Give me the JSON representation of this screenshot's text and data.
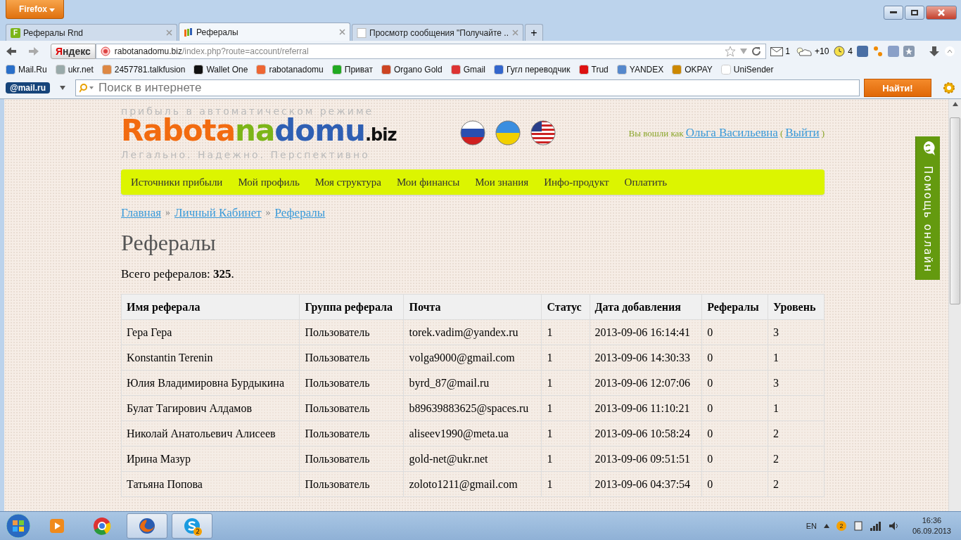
{
  "window": {
    "app_button": "Firefox"
  },
  "tabs": [
    {
      "label": "Рефералы Rnd",
      "kind": "letter",
      "icon": "F",
      "selected": false
    },
    {
      "label": "Рефералы",
      "kind": "bars",
      "selected": true
    },
    {
      "label": "Просмотр сообщения \"Получайте ...",
      "kind": "blank",
      "selected": false
    }
  ],
  "new_tab": "+",
  "navbar": {
    "search_engine": "Яндекс",
    "url_host": "rabotanadomu.biz",
    "url_path": "/index.php?route=account/referral",
    "mail_count": "1",
    "weather": "+10",
    "time_count": "4"
  },
  "bookmarks": [
    "Mail.Ru",
    "ukr.net",
    "2457781.talkfusion",
    "Wallet One",
    "rabotanadomu",
    "Приват",
    "Organo Gold",
    "Gmail",
    "Гугл переводчик",
    "Trud",
    "YANDEX",
    "OKPAY",
    "UniSender"
  ],
  "mailru_bar": {
    "logo": "@mail.ru",
    "placeholder": "Поиск в интернете",
    "button": "Найти!"
  },
  "site": {
    "tagline_top": "прибыль в автоматическом режиме",
    "logo": [
      {
        "text": "Rabota",
        "color": "#f26b10"
      },
      {
        "text": "na",
        "color": "#7cb518"
      },
      {
        "text": "domu",
        "color": "#2f5fb3"
      },
      {
        "text": ".biz",
        "color": "#111111"
      }
    ],
    "tagline_bottom": "Легально. Надежно. Перспективно",
    "login": {
      "prefix": "Вы вошли как",
      "user": "Ольга Васильевна",
      "open": "(",
      "logout": "Выйти",
      "close": ")"
    },
    "menu": [
      "Источники прибыли",
      "Мой профиль",
      "Моя структура",
      "Мои финансы",
      "Мои знания",
      "Инфо-продукт",
      "Оплатить"
    ],
    "breadcrumbs": [
      "Главная",
      "Личный Кабинет",
      "Рефералы"
    ],
    "breadcrumb_separator": "»",
    "heading": "Рефералы",
    "total": "Всего рефералов: **325**.",
    "help": "Помощь онлайн"
  },
  "table": {
    "columns": [
      "Имя реферала",
      "Группа реферала",
      "Почта",
      "Статус",
      "Дата добавления",
      "Рефералы",
      "Уровень"
    ],
    "rows": [
      [
        "Гера Гера",
        "Пользователь",
        "torek.vadim@yandex.ru",
        "1",
        "2013-09-06 16:14:41",
        "0",
        "3"
      ],
      [
        "Konstantin Terenin",
        "Пользователь",
        "volga9000@gmail.com",
        "1",
        "2013-09-06 14:30:33",
        "0",
        "1"
      ],
      [
        "Юлия Владимировна Бурдыкина",
        "Пользователь",
        "byrd_87@mail.ru",
        "1",
        "2013-09-06 12:07:06",
        "0",
        "3"
      ],
      [
        "Булат Тагирович Алдамов",
        "Пользователь",
        "b89639883625@spaces.ru",
        "1",
        "2013-09-06 11:10:21",
        "0",
        "1"
      ],
      [
        "Николай Анатольевич Алисеев",
        "Пользователь",
        "aliseev1990@meta.ua",
        "1",
        "2013-09-06 10:58:24",
        "0",
        "2"
      ],
      [
        "Ирина Мазур",
        "Пользователь",
        "gold-net@ukr.net",
        "1",
        "2013-09-06 09:51:51",
        "0",
        "2"
      ],
      [
        "Татьяна Попова",
        "Пользователь",
        "zoloto1211@gmail.com",
        "1",
        "2013-09-06 04:37:54",
        "0",
        "2"
      ]
    ]
  },
  "taskbar": {
    "apps": [
      {
        "kind": "media",
        "active": false
      },
      {
        "kind": "chrome",
        "active": false
      },
      {
        "kind": "firefox",
        "active": true
      },
      {
        "kind": "skype",
        "active": true,
        "badge": "2"
      }
    ],
    "tray": {
      "lang": "EN",
      "badge": "2",
      "time": "16:36",
      "date": "06.09.2013"
    }
  }
}
